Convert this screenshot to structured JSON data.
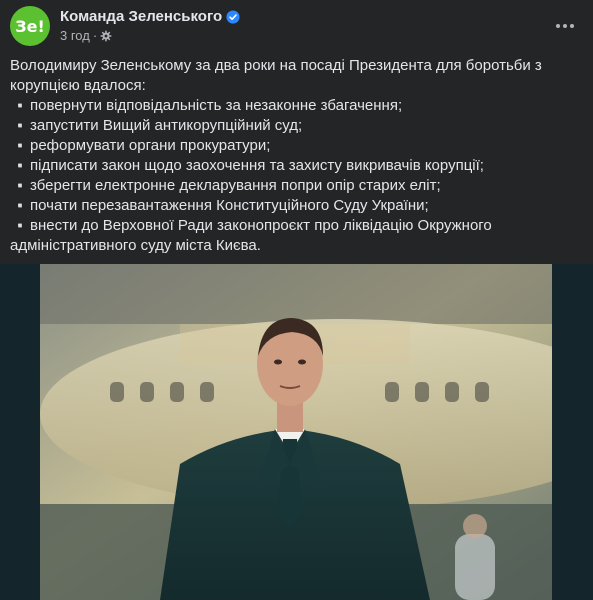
{
  "post": {
    "page_name": "Команда Зеленського",
    "avatar_text": "Зе!",
    "timestamp": "3 год",
    "separator": "·",
    "intro": "Володимиру Зеленському за два роки на посаді Президента для боротьби з корупцією вдалося:",
    "bullet_symbol": "▫️",
    "items": [
      "повернути відповідальність за незаконне збагачення;",
      "запустити Вищий антикорупційний суд;",
      "реформувати органи прокуратури;",
      "підписати закон щодо заохочення та захисту викривачів корупції;",
      "зберегти електронне декларування попри опір старих еліт;",
      "почати перезавантаження Конституційного Суду України;",
      "внести до Верховної Ради законопроєкт про ліквідацію Окружного адміністративного суду міста Києва."
    ]
  },
  "icons": {
    "verified": "verified-badge-icon",
    "audience": "gear-icon",
    "more": "more-options-icon"
  },
  "colors": {
    "background": "#242526",
    "avatar_green": "#5cc130",
    "verified_blue": "#2d88ff",
    "text_primary": "#e4e6eb",
    "text_secondary": "#b0b3b8"
  }
}
